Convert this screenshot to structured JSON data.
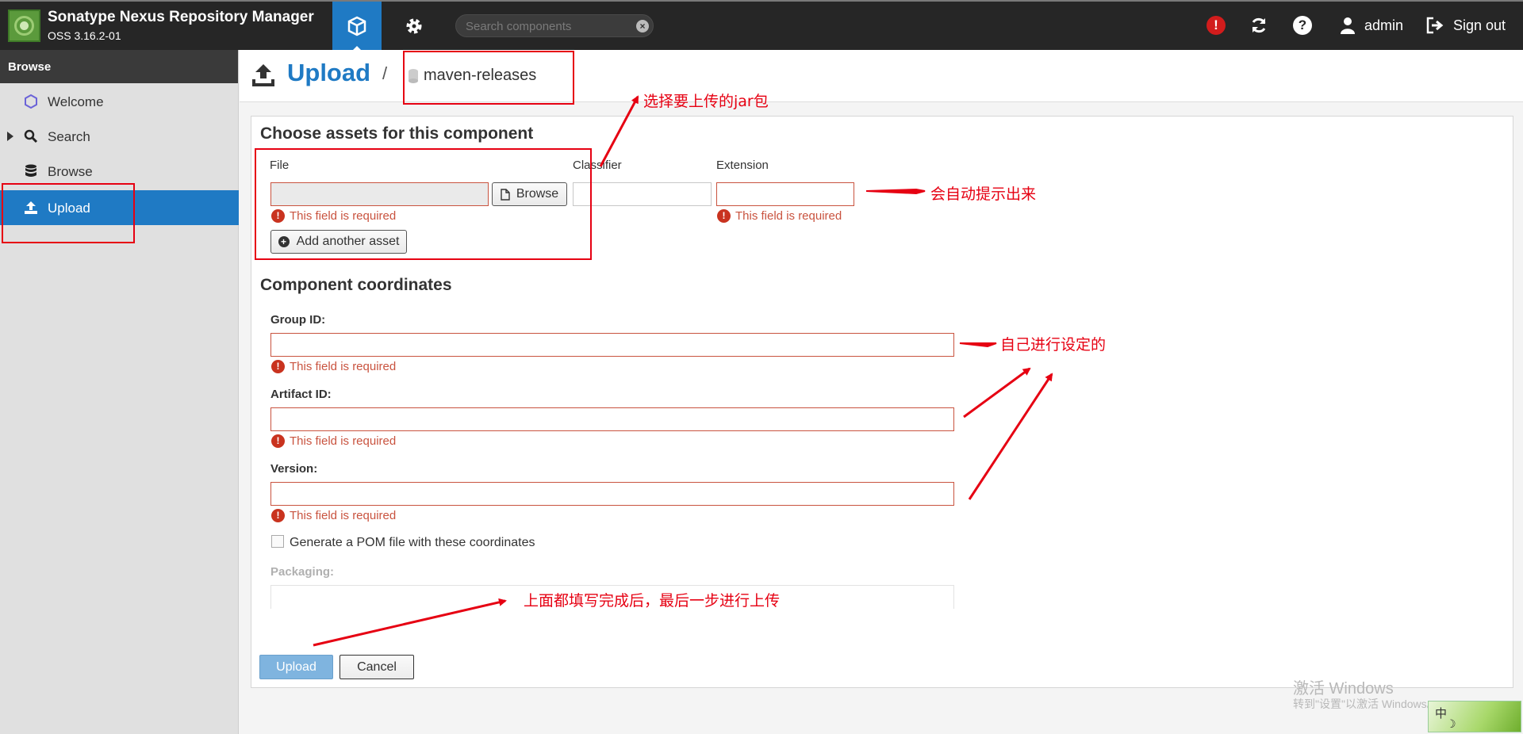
{
  "header": {
    "app_title": "Sonatype Nexus Repository Manager",
    "app_version": "OSS 3.16.2-01",
    "search_placeholder": "Search components",
    "user": "admin",
    "sign_out": "Sign out"
  },
  "sidebar": {
    "heading": "Browse",
    "items": [
      {
        "label": "Welcome",
        "icon": "hexagon-icon"
      },
      {
        "label": "Search",
        "icon": "search-icon"
      },
      {
        "label": "Browse",
        "icon": "database-icon"
      },
      {
        "label": "Upload",
        "icon": "upload-icon"
      }
    ]
  },
  "breadcrumb": {
    "title": "Upload",
    "separator": "/",
    "repository": "maven-releases"
  },
  "assets": {
    "section_title": "Choose assets for this component",
    "file_label": "File",
    "classifier_label": "Classifier",
    "extension_label": "Extension",
    "browse_label": "Browse",
    "required_error": "This field is required",
    "add_asset_label": "Add another asset"
  },
  "coordinates": {
    "section_title": "Component coordinates",
    "group_label": "Group ID:",
    "artifact_label": "Artifact ID:",
    "version_label": "Version:",
    "required_error": "This field is required",
    "generate_pom_label": "Generate a POM file with these coordinates",
    "packaging_label": "Packaging:"
  },
  "actions": {
    "upload_label": "Upload",
    "cancel_label": "Cancel"
  },
  "annotations": {
    "select_jar": "选择要上传的jar包",
    "auto_hint": "会自动提示出来",
    "self_set": "自己进行设定的",
    "final_step": "上面都填写完成后，最后一步进行上传"
  },
  "watermark": {
    "line1": "激活 Windows",
    "line2": "转到\"设置\"以激活 Windows。",
    "ime_char": "中"
  },
  "colors": {
    "accent": "#1f7ac4",
    "header_bg": "#262626",
    "error": "#c9533f",
    "annotation": "#e60012"
  }
}
